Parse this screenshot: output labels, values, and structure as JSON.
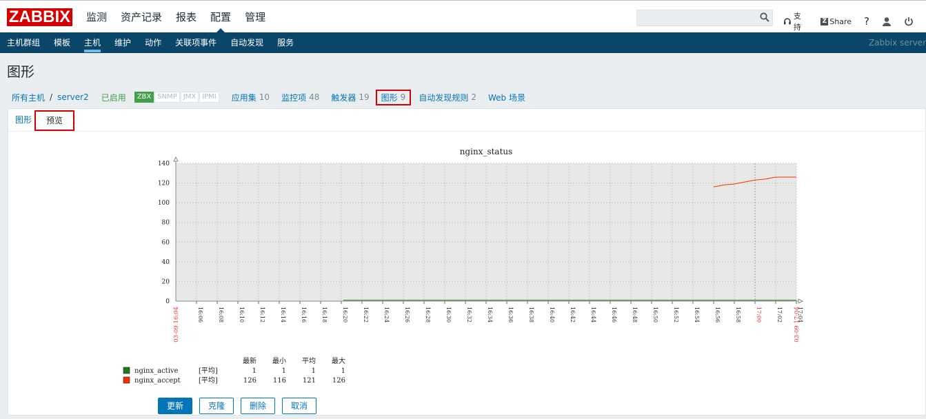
{
  "logo": "ZABBIX",
  "main_menu": [
    {
      "label": "监测",
      "selected": false
    },
    {
      "label": "资产记录",
      "selected": false
    },
    {
      "label": "报表",
      "selected": false
    },
    {
      "label": "配置",
      "selected": true
    },
    {
      "label": "管理",
      "selected": false
    }
  ],
  "search": {
    "value": "",
    "placeholder": ""
  },
  "top_links": {
    "support": "支持",
    "share": "Share",
    "help": "?"
  },
  "sub_menu": [
    {
      "label": "主机群组",
      "selected": false
    },
    {
      "label": "模板",
      "selected": false
    },
    {
      "label": "主机",
      "selected": true
    },
    {
      "label": "维护",
      "selected": false
    },
    {
      "label": "动作",
      "selected": false
    },
    {
      "label": "关联项事件",
      "selected": false
    },
    {
      "label": "自动发现",
      "selected": false
    },
    {
      "label": "服务",
      "selected": false
    }
  ],
  "server_name": "Zabbix server",
  "page_title": "图形",
  "breadcrumb": {
    "all_hosts": "所有主机",
    "separator": "/",
    "host": "server2",
    "status": "已启用"
  },
  "availability": [
    "ZBX",
    "SNMP",
    "JMX",
    "IPMI"
  ],
  "host_nav": [
    {
      "label": "应用集",
      "count": "10"
    },
    {
      "label": "监控项",
      "count": "48"
    },
    {
      "label": "触发器",
      "count": "19"
    },
    {
      "label": "图形",
      "count": "9"
    },
    {
      "label": "自动发现规则",
      "count": "2"
    },
    {
      "label": "Web 场景",
      "count": ""
    }
  ],
  "tabs": {
    "graph": "图形",
    "preview": "预览"
  },
  "legend_header": {
    "last": "最新",
    "min": "最小",
    "avg": "平均",
    "max": "最大"
  },
  "buttons": {
    "update": "更新",
    "clone": "克隆",
    "delete": "删除",
    "cancel": "取消"
  },
  "colors": {
    "accent": "#0275b8",
    "brand": "#d40000",
    "nav_bg": "#0a466a",
    "series_active": "#1a7c1a",
    "series_accept": "#f63100"
  },
  "chart_data": {
    "type": "line",
    "title": "nginx_status",
    "ylim": [
      0,
      140
    ],
    "y_ticks": [
      "0",
      "20",
      "40",
      "60",
      "80",
      "100",
      "120",
      "140"
    ],
    "x_ticks": [
      "16:06",
      "16:08",
      "16:10",
      "16:12",
      "16:14",
      "16:16",
      "16:18",
      "16:20",
      "16:22",
      "16:24",
      "16:26",
      "16:28",
      "16:30",
      "16:32",
      "16:34",
      "16:36",
      "16:38",
      "16:40",
      "16:42",
      "16:44",
      "16:46",
      "16:48",
      "16:50",
      "16:52",
      "16:54",
      "16:56",
      "16:58",
      "17:00",
      "17:02",
      "17:04"
    ],
    "x_start_label": "03-09 16:04",
    "x_end_label": "03-09 17:04",
    "grid": true,
    "series": [
      {
        "name": "nginx_active",
        "func": "[平均]",
        "last": "1",
        "min": "1",
        "avg": "1",
        "max": "1",
        "color": "#1a7c1a",
        "points": [
          [
            16.2,
            1
          ],
          [
            60,
            1
          ]
        ]
      },
      {
        "name": "nginx_accept",
        "func": "[平均]",
        "last": "126",
        "min": "116",
        "avg": "121",
        "max": "126",
        "color": "#f63100",
        "points": [
          [
            52,
            116
          ],
          [
            53,
            118
          ],
          [
            54,
            119
          ],
          [
            55,
            121
          ],
          [
            56,
            123
          ],
          [
            57,
            124
          ],
          [
            58,
            126
          ],
          [
            59,
            126
          ],
          [
            60,
            126
          ]
        ]
      }
    ]
  }
}
